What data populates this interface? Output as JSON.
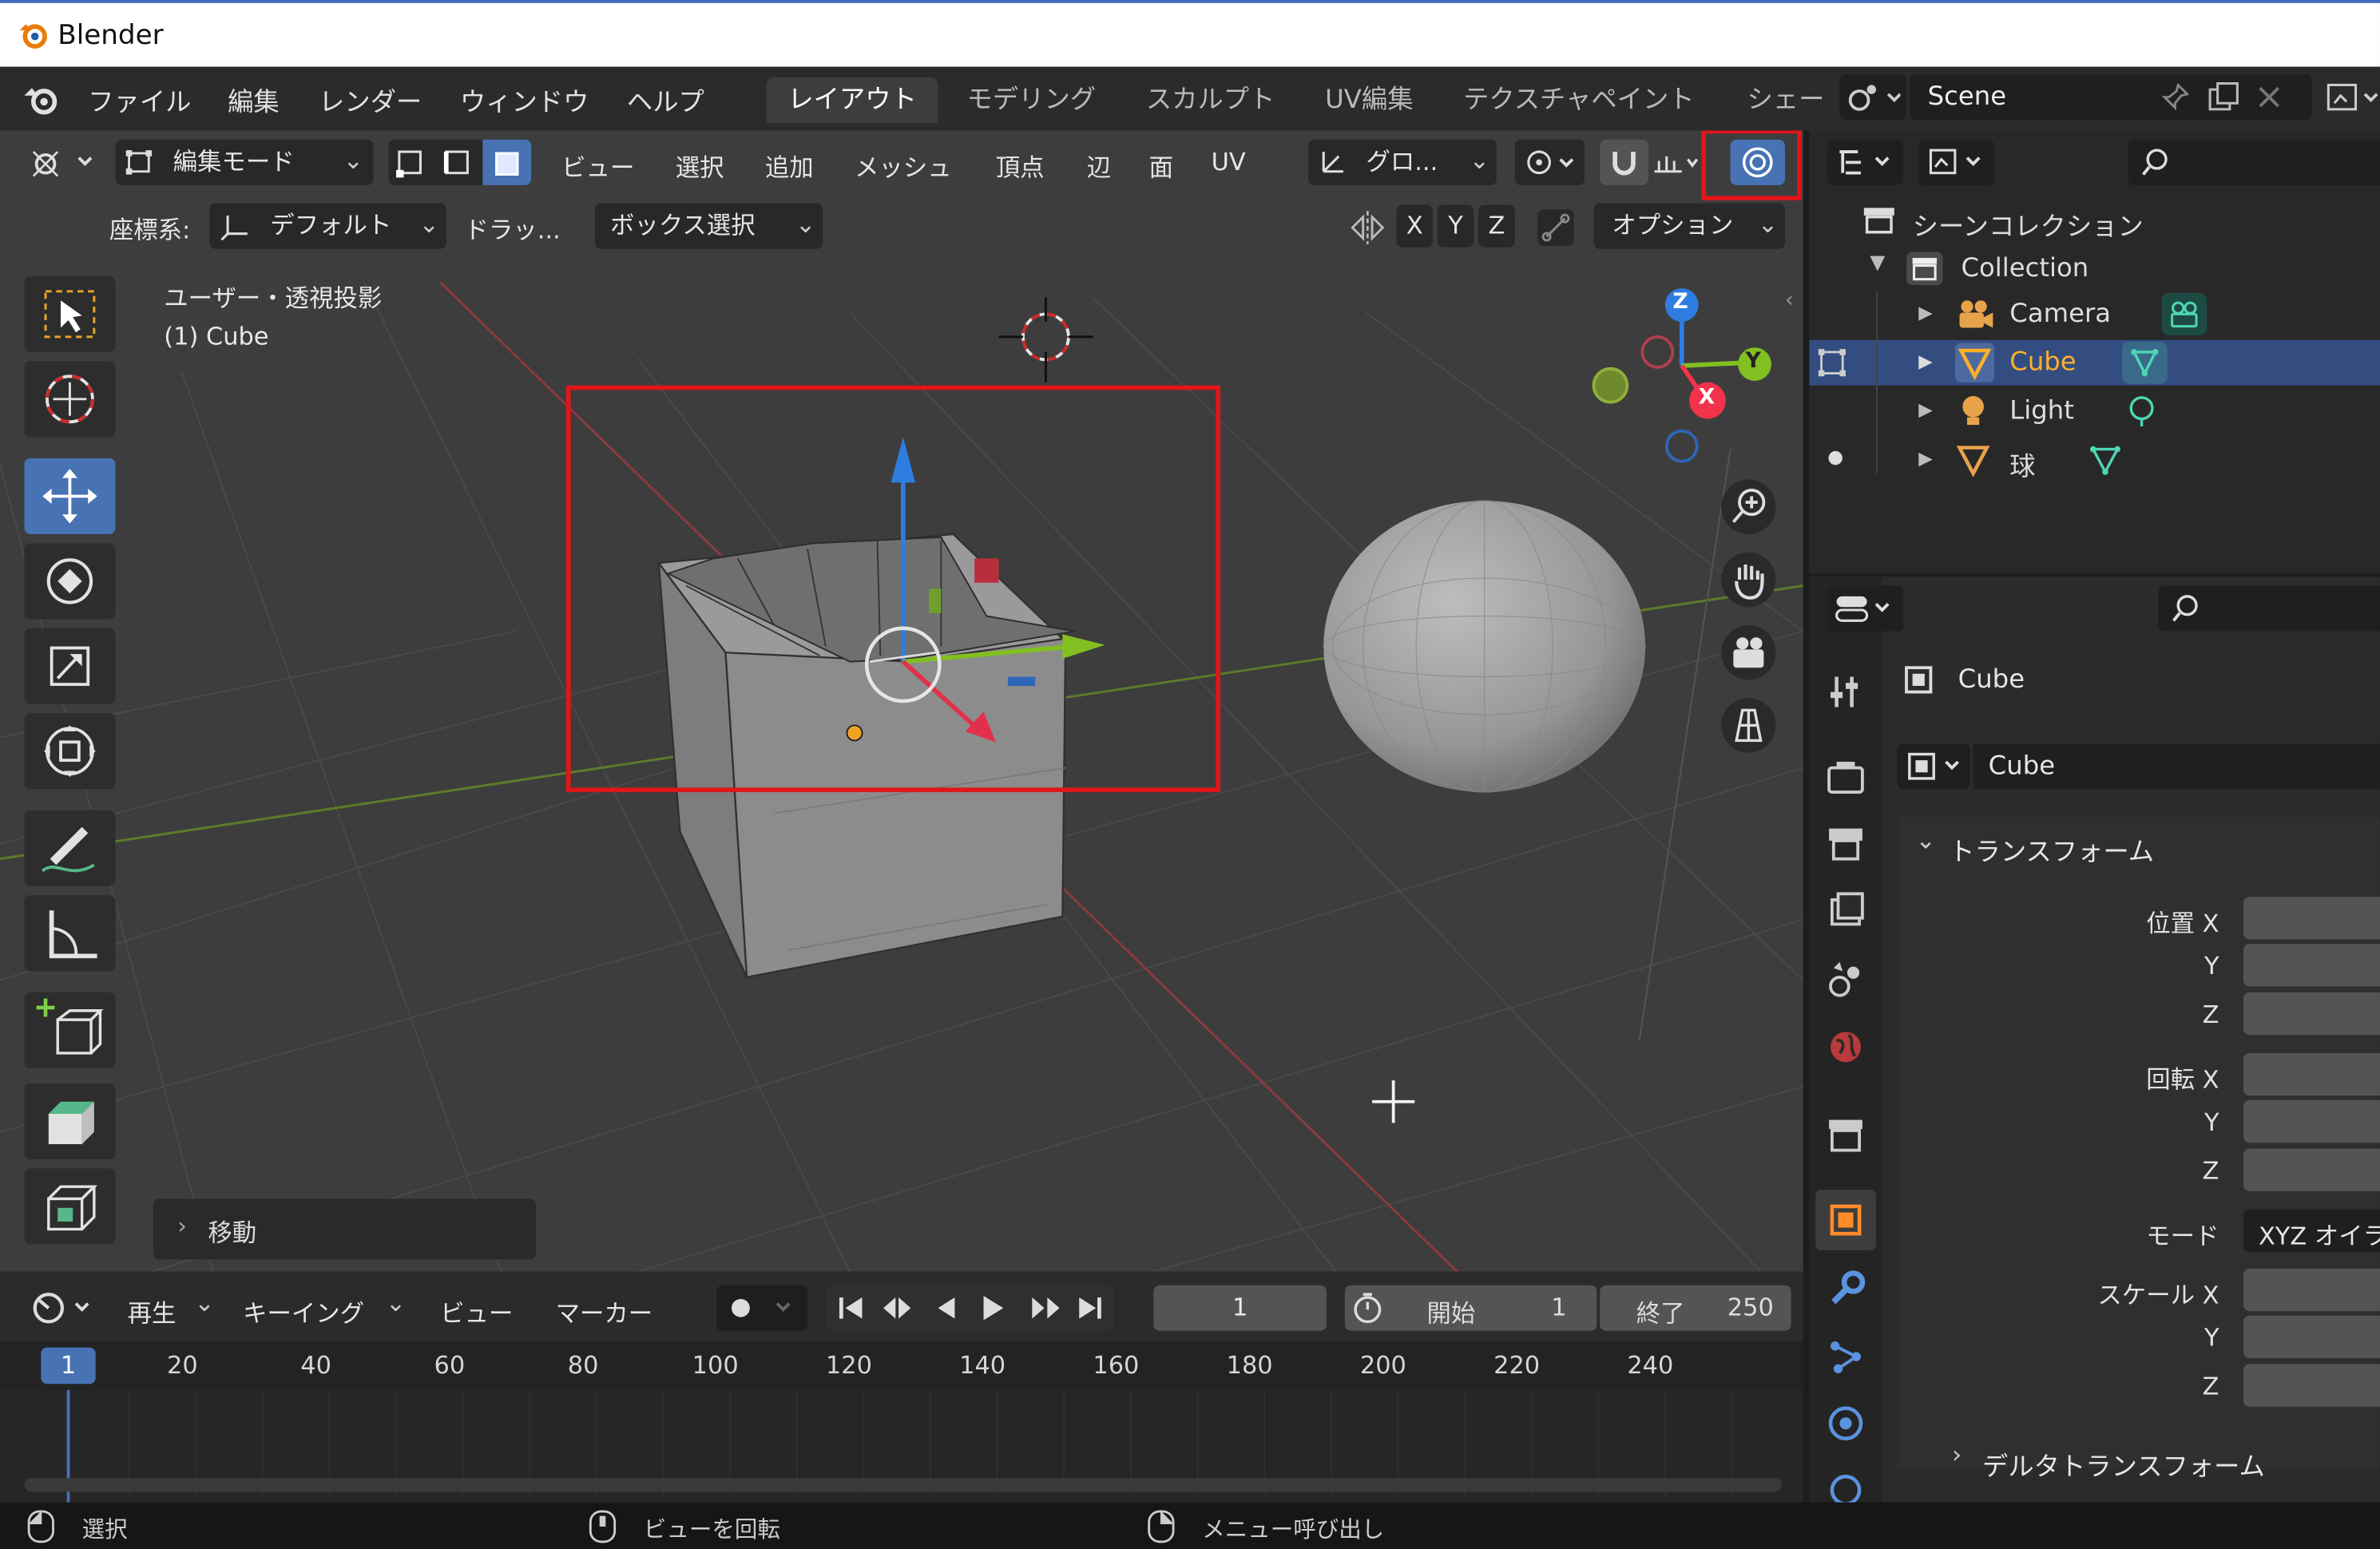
{
  "window": {
    "title": "Blender"
  },
  "menu": {
    "items": [
      "ファイル",
      "編集",
      "レンダー",
      "ウィンドウ",
      "ヘルプ"
    ],
    "workspaces": [
      "レイアウト",
      "モデリング",
      "スカルプト",
      "UV編集",
      "テクスチャペイント",
      "シェー"
    ],
    "scene": "Scene"
  },
  "viewport_header": {
    "mode": "編集モード",
    "menus": [
      "ビュー",
      "選択",
      "追加",
      "メッシュ",
      "頂点",
      "辺",
      "面",
      "UV"
    ],
    "transform_orientation": "グロ...",
    "coord_label": "座標系:",
    "coord_value": "デフォルト",
    "drag_label": "ドラッ...",
    "drag_value": "ボックス選択",
    "axes": [
      "X",
      "Y",
      "Z"
    ],
    "options": "オプション"
  },
  "overlay_text": {
    "view_name": "ユーザー・透視投影",
    "object_name": "(1) Cube",
    "operator_panel": "移動"
  },
  "gizmo_axes": {
    "z": "Z",
    "y": "Y",
    "x": "X"
  },
  "timeline": {
    "menus": [
      "再生",
      "キーイング",
      "ビュー",
      "マーカー"
    ],
    "current_frame": "1",
    "start_label": "開始",
    "start_value": "1",
    "end_label": "終了",
    "end_value": "250",
    "ruler_ticks": [
      "1",
      "20",
      "40",
      "60",
      "80",
      "100",
      "120",
      "140",
      "160",
      "180",
      "200",
      "220",
      "240"
    ]
  },
  "outliner": {
    "scene_collection": "シーンコレクション",
    "collection": "Collection",
    "objects": [
      {
        "name": "Camera",
        "selected": false
      },
      {
        "name": "Cube",
        "selected": true
      },
      {
        "name": "Light",
        "selected": false
      },
      {
        "name": "球",
        "selected": false
      }
    ]
  },
  "properties": {
    "object_name": "Cube",
    "object_field": "Cube",
    "transform_header": "トランスフォーム",
    "location_label_x": "位置 X",
    "rotation_label_x": "回転 X",
    "label_y": "Y",
    "label_z": "Z",
    "mode_label": "モード",
    "mode_value": "XYZ オイラ",
    "scale_label_x": "スケール X",
    "delta_transform": "デルタトランスフォーム"
  },
  "statusbar": {
    "select": "選択",
    "rotate": "ビューを回転",
    "menu": "メニュー呼び出し"
  },
  "colors": {
    "accent": "#4772b3",
    "highlight_red": "#e0161b",
    "x_axis": "#f2334b",
    "y_axis": "#82bf21",
    "z_axis": "#2f7de0",
    "selected_text": "#ffaf29"
  }
}
